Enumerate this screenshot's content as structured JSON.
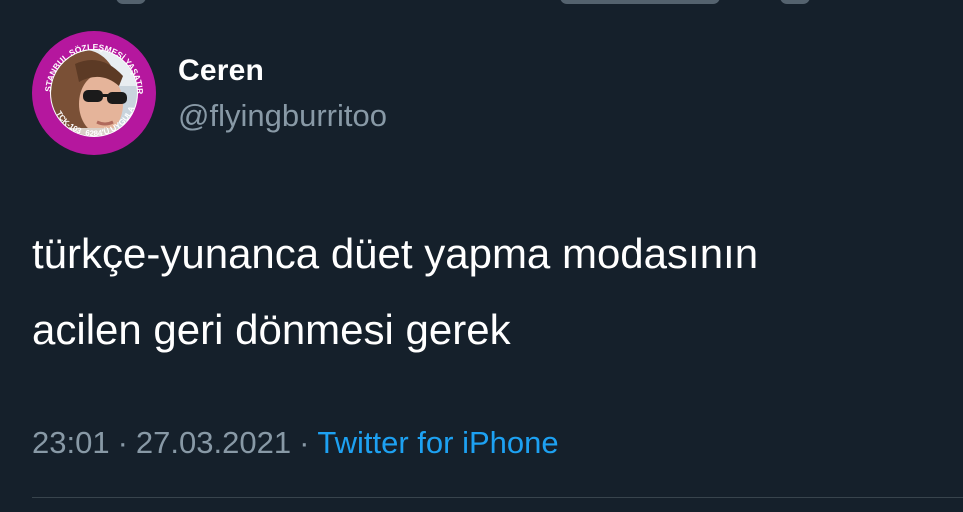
{
  "tweet": {
    "author": {
      "name": "Ceren",
      "handle": "@flyingburritoo",
      "avatar_ring_text": "İSTANBUL SÖZLEŞMESİ YAŞATIR",
      "avatar_ring_text_left": "TCK-103",
      "avatar_ring_text_bottom": "6284'Ü UYGULA"
    },
    "text_lines": [
      "türkçe-yunanca düet yapma modasının",
      "acilen geri dönmesi gerek"
    ],
    "time": "23:01",
    "date": "27.03.2021",
    "separator": "·",
    "source": "Twitter for iPhone"
  },
  "colors": {
    "background": "#15202b",
    "primary_text": "#ffffff",
    "secondary_text": "#8899a6",
    "link": "#1da1f2",
    "avatar_ring": "#b5179e",
    "divider": "#38444d"
  }
}
